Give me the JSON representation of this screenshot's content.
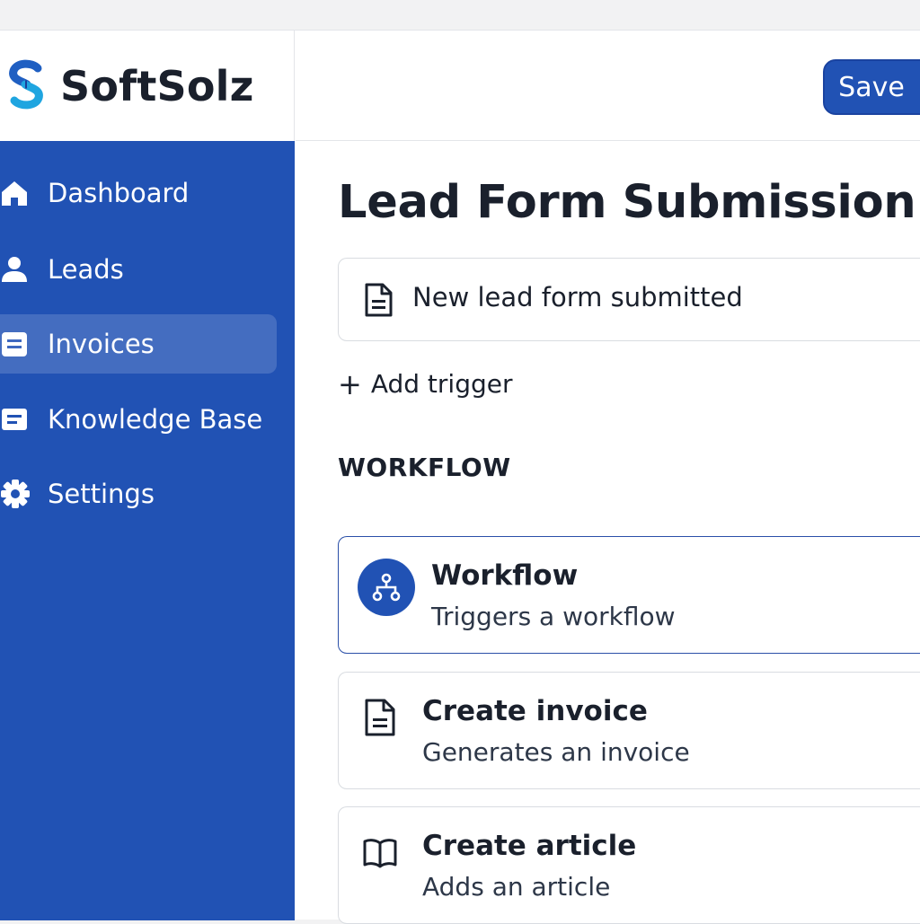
{
  "brand": {
    "name": "SoftSolz"
  },
  "colors": {
    "primary": "#2152b4",
    "text": "#1a202c",
    "border": "#d9dce1"
  },
  "sidebar": {
    "items": [
      {
        "label": "Dashboard",
        "icon": "home-icon",
        "active": false
      },
      {
        "label": "Leads",
        "icon": "user-icon",
        "active": false
      },
      {
        "label": "Invoices",
        "icon": "document-icon",
        "active": true
      },
      {
        "label": "Knowledge Base",
        "icon": "document-icon",
        "active": false
      },
      {
        "label": "Settings",
        "icon": "gear-icon",
        "active": false
      }
    ]
  },
  "header": {
    "save_label": "Save"
  },
  "main": {
    "title": "Lead Form Submission",
    "trigger": {
      "label": "New lead form submitted",
      "icon": "document-icon"
    },
    "add_trigger_label": "Add trigger",
    "workflow_heading": "WORKFLOW",
    "actions": [
      {
        "title": "Workflow",
        "description": "Triggers a workflow",
        "icon": "workflow-icon",
        "selected": true
      },
      {
        "title": "Create invoice",
        "description": "Generates an invoice",
        "icon": "file-icon",
        "selected": false
      },
      {
        "title": "Create article",
        "description": "Adds an article",
        "icon": "book-icon",
        "selected": false
      }
    ]
  }
}
